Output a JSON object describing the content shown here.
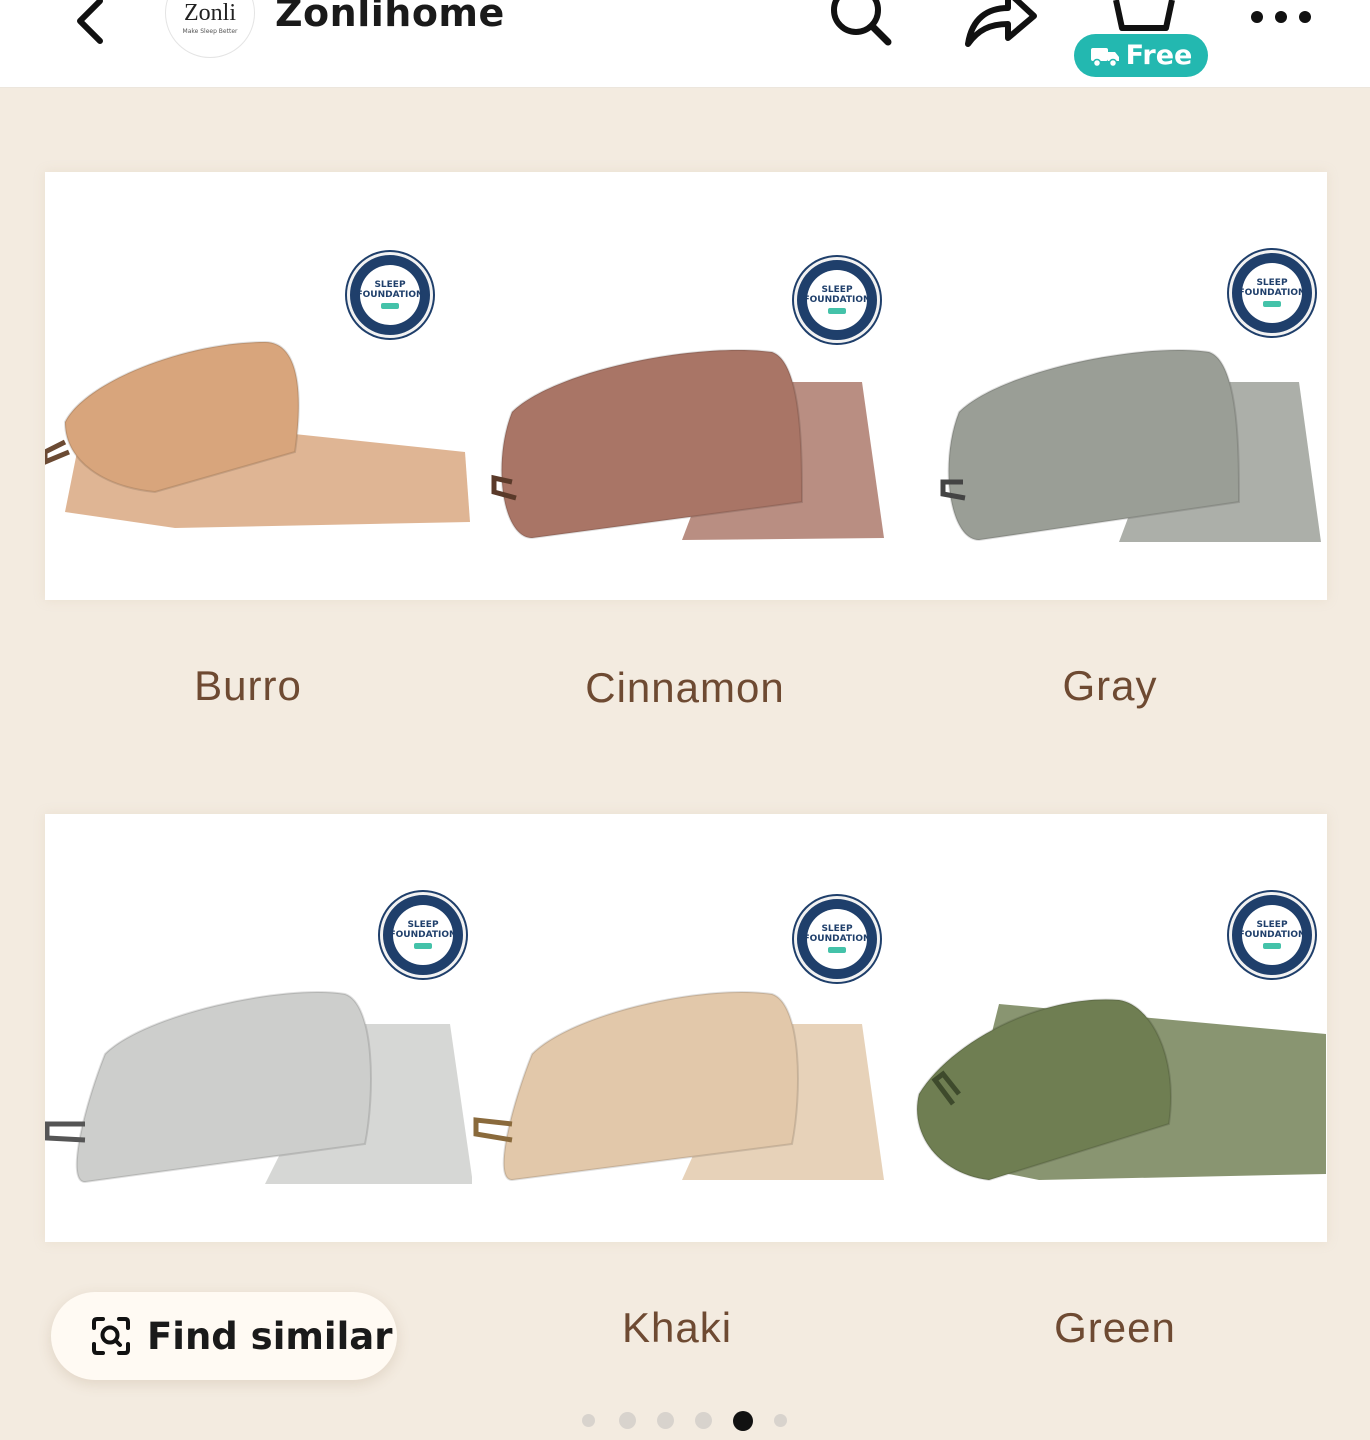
{
  "header": {
    "store_logo_word": "Zonli",
    "store_logo_tagline": "Make Sleep Better",
    "store_name": "Zonlihome",
    "free_badge": "Free",
    "icons": [
      "chevron-left-icon",
      "search-icon",
      "share-icon",
      "cart-icon",
      "truck-icon",
      "more-icon"
    ]
  },
  "seal": {
    "line1": "SLEEP",
    "line2": "FOUNDATION"
  },
  "variants": [
    {
      "label": "Burro",
      "color": "#d8a57c"
    },
    {
      "label": "Cinnamon",
      "color": "#a97566"
    },
    {
      "label": "Gray",
      "color": "#9a9e96"
    },
    {
      "label": "",
      "color": "#cdcecc"
    },
    {
      "label": "Khaki",
      "color": "#e2c8aa"
    },
    {
      "label": "Green",
      "color": "#6f7e52"
    }
  ],
  "find_similar": {
    "label": "Find similar"
  },
  "pagination": {
    "count": 6,
    "active_index": 4
  },
  "colors": {
    "background": "#f3ebe0",
    "accent": "#23b8b0",
    "label_text": "#6e4a32"
  }
}
